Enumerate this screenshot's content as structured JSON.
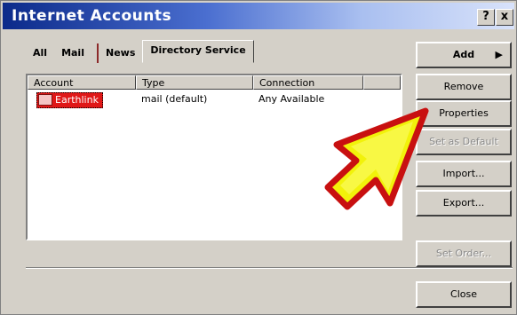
{
  "window": {
    "title": "Internet Accounts",
    "help_label": "?",
    "close_label": "x"
  },
  "tabs": [
    {
      "label": "All"
    },
    {
      "label": "Mail"
    },
    {
      "label": "News"
    },
    {
      "label": "Directory Service"
    }
  ],
  "list": {
    "columns": [
      "Account",
      "Type",
      "Connection"
    ],
    "rows": [
      {
        "account": "Earthlink",
        "type": "mail (default)",
        "connection": "Any Available"
      }
    ]
  },
  "buttons": {
    "add": "Add",
    "remove": "Remove",
    "properties": "Properties",
    "set_default": "Set as Default",
    "import": "Import...",
    "export": "Export...",
    "set_order": "Set Order...",
    "close": "Close"
  },
  "colors": {
    "title_gradient_start": "#0b2a8a",
    "selection_red": "#e01818",
    "pointer_yellow": "#f2f20a",
    "pointer_red": "#c81010"
  },
  "icons": {
    "add_arrow": "triangle-right",
    "pointer": "big-arrow-pointer"
  }
}
